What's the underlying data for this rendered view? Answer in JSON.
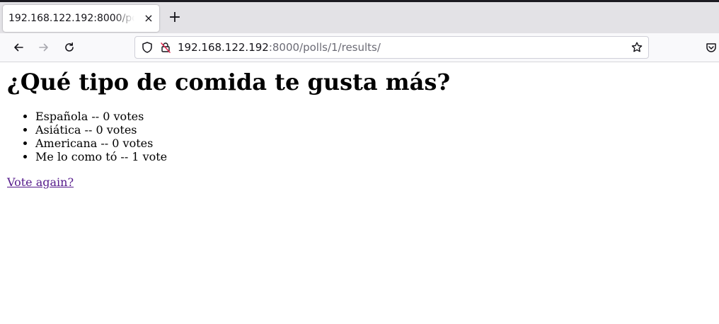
{
  "browser": {
    "tab": {
      "title": "192.168.122.192:8000/polls/1/results/",
      "close_glyph": "×"
    },
    "new_tab_glyph": "+",
    "url": {
      "host": "192.168.122.192",
      "rest": ":8000/polls/1/results/"
    },
    "icons": [
      "back-arrow-icon",
      "forward-arrow-icon",
      "reload-icon",
      "shield-icon",
      "insecure-lock-icon",
      "bookmark-star-icon",
      "pocket-icon"
    ]
  },
  "page": {
    "question": "¿Qué tipo de comida te gusta más?",
    "choices": [
      {
        "text": "Española -- 0 votes"
      },
      {
        "text": "Asiática -- 0 votes"
      },
      {
        "text": "Americana -- 0 votes"
      },
      {
        "text": "Me lo como tó -- 1 vote"
      }
    ],
    "vote_again_link": "Vote again?"
  }
}
